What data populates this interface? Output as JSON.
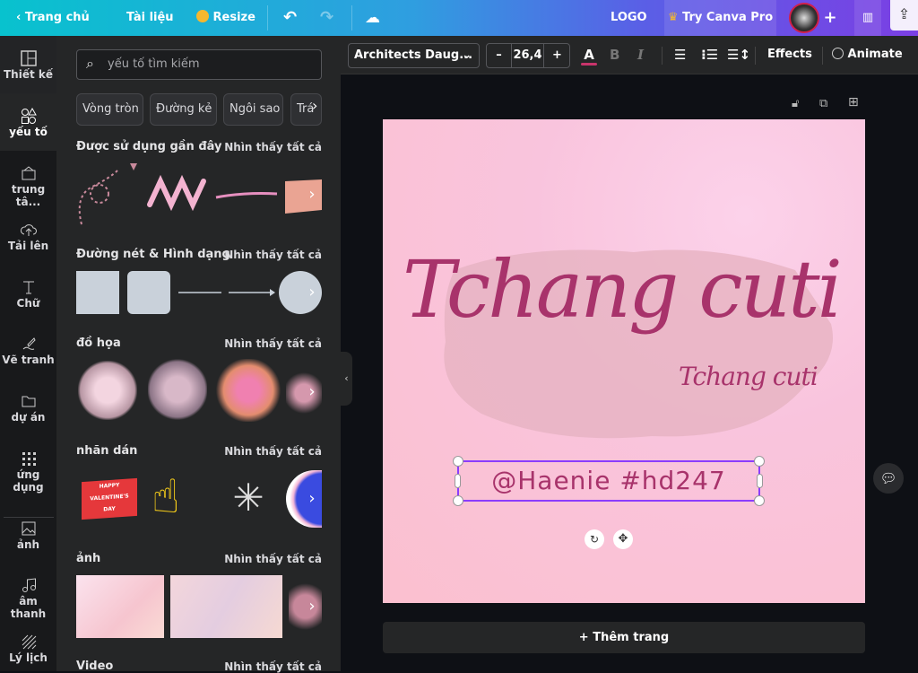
{
  "topbar": {
    "home": "Trang chủ",
    "file": "Tài liệu",
    "resize": "Resize",
    "doc_title": "LOGO",
    "try_pro": "Try Canva Pro",
    "add": "+"
  },
  "rail": [
    {
      "label": "Thiết kế"
    },
    {
      "label": "yếu tố"
    },
    {
      "label": "trung tâ..."
    },
    {
      "label": "Tải lên"
    },
    {
      "label": "Chữ"
    },
    {
      "label": "Vẽ tranh"
    },
    {
      "label": "dự án"
    },
    {
      "label": "ứng dụng"
    },
    {
      "label": "ảnh"
    },
    {
      "label": "âm thanh"
    },
    {
      "label": "Lý lịch"
    }
  ],
  "panel": {
    "search_placeholder": "yếu tố tìm kiếm",
    "chips": [
      "Vòng tròn",
      "Đường kẻ",
      "Ngôi sao",
      "Trá"
    ],
    "see_all": "Nhìn thấy tất cả",
    "sections": [
      "Được sử dụng gần đây",
      "Đường nét & Hình dạng",
      "đồ họa",
      "nhãn dán",
      "ảnh",
      "Video"
    ],
    "sticker_text": [
      "HAPPY",
      "VALENTINE'S",
      "DAY"
    ]
  },
  "toolbar": {
    "font": "Architects Daug...",
    "minus": "–",
    "size": "26,4",
    "plus": "+",
    "color_letter": "A",
    "bold": "B",
    "italic": "I",
    "effects": "Effects",
    "animate": "Animate"
  },
  "canvas": {
    "title": "Tchang cuti",
    "subtitle": "Tchang cuti",
    "handle": "@Haenie #hd247",
    "add_page": "+ Thêm trang"
  },
  "colors": {
    "accent": "#a8336b",
    "selection": "#8b3dff"
  }
}
